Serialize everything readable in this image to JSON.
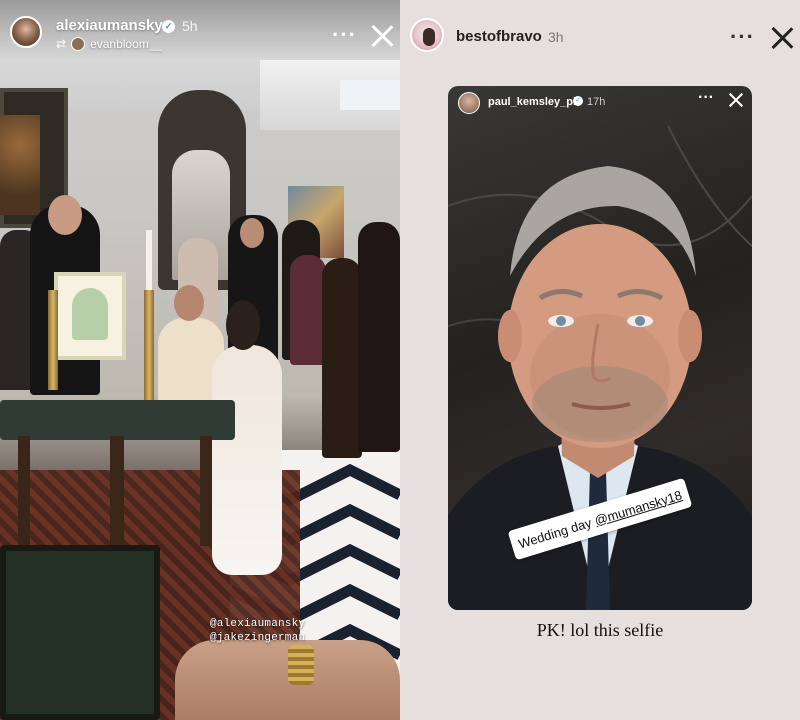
{
  "left_story": {
    "username": "alexiaumansky",
    "time": "5h",
    "reposted_from": "evanbloom__",
    "mentions": [
      "@alexiaumansky",
      "@jakezingerman"
    ],
    "icons": [
      "verified-badge-icon",
      "repost-icon",
      "more-icon",
      "close-icon"
    ]
  },
  "right_story": {
    "username": "bestofbravo",
    "time": "3h",
    "shared_post": {
      "username": "paul_kemsley_pk",
      "time": "17h",
      "sticker_text": "Wedding day",
      "sticker_handle": "@mumansky18"
    },
    "caption": "PK! lol this selfie",
    "icons": [
      "verified-badge-icon",
      "more-icon",
      "close-icon"
    ]
  },
  "colors": {
    "right_background": "#e7dfdd",
    "verified_blue": "#3b8ed8"
  }
}
